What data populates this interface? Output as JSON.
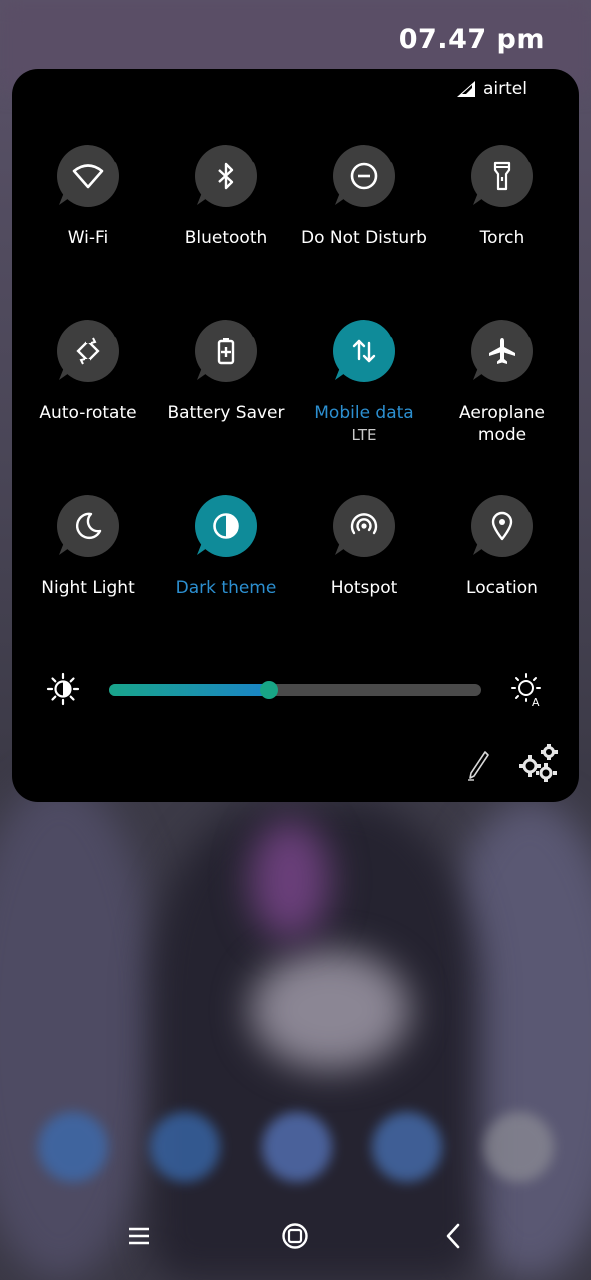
{
  "status_bar": {
    "time": "07.47 pm"
  },
  "panel": {
    "carrier": "airtel",
    "tiles": [
      {
        "label": "Wi-Fi",
        "icon": "wifi-icon",
        "active": false
      },
      {
        "label": "Bluetooth",
        "icon": "bluetooth-icon",
        "active": false
      },
      {
        "label": "Do Not Disturb",
        "icon": "do-not-disturb-icon",
        "active": false
      },
      {
        "label": "Torch",
        "icon": "torch-icon",
        "active": false
      },
      {
        "label": "Auto-rotate",
        "icon": "auto-rotate-icon",
        "active": false
      },
      {
        "label": "Battery Saver",
        "icon": "battery-saver-icon",
        "active": false
      },
      {
        "label": "Mobile data",
        "sub": "LTE",
        "icon": "mobile-data-icon",
        "active": true
      },
      {
        "label": "Aeroplane\nmode",
        "icon": "aeroplane-icon",
        "active": false
      },
      {
        "label": "Night Light",
        "icon": "night-light-icon",
        "active": false
      },
      {
        "label": "Dark theme",
        "icon": "dark-theme-icon",
        "active": true
      },
      {
        "label": "Hotspot",
        "icon": "hotspot-icon",
        "active": false
      },
      {
        "label": "Location",
        "icon": "location-icon",
        "active": false
      }
    ],
    "brightness": {
      "level": 0.43
    }
  },
  "colors": {
    "panel_bg": "#000000",
    "tile_off": "#3e3e3e",
    "tile_on": "#0f8b99",
    "active_label": "#2c8fd0",
    "slider_gradient_start": "#19a58b",
    "slider_gradient_end": "#1a84c6"
  },
  "navigation": {
    "items": [
      "menu-icon",
      "home-icon",
      "back-icon"
    ]
  }
}
